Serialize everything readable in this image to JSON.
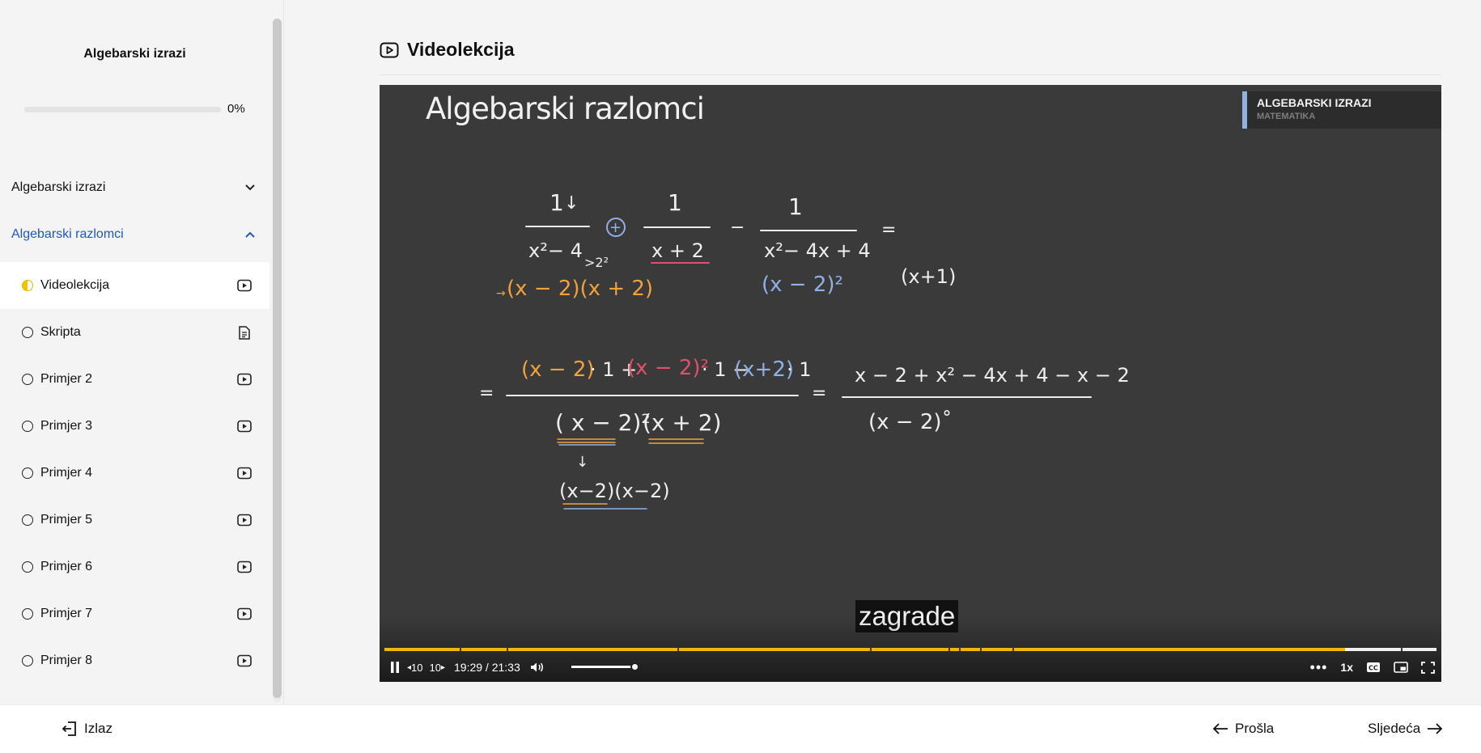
{
  "course": {
    "title": "Algebarski izrazi",
    "progress_percent": 0,
    "progress_label": "0%"
  },
  "sections": [
    {
      "label": "Algebarski izrazi",
      "expanded": false
    },
    {
      "label": "Algebarski razlomci",
      "expanded": true
    }
  ],
  "lessons": [
    {
      "label": "Videolekcija",
      "status": "in-progress",
      "icon": "video-icon",
      "current": true
    },
    {
      "label": "Skripta",
      "status": "not-started",
      "icon": "document-icon"
    },
    {
      "label": "Primjer 2",
      "status": "not-started",
      "icon": "video-icon"
    },
    {
      "label": "Primjer 3",
      "status": "not-started",
      "icon": "video-icon"
    },
    {
      "label": "Primjer 4",
      "status": "not-started",
      "icon": "video-icon"
    },
    {
      "label": "Primjer 5",
      "status": "not-started",
      "icon": "video-icon"
    },
    {
      "label": "Primjer 6",
      "status": "not-started",
      "icon": "video-icon"
    },
    {
      "label": "Primjer 7",
      "status": "not-started",
      "icon": "video-icon"
    },
    {
      "label": "Primjer 8",
      "status": "not-started",
      "icon": "video-icon"
    }
  ],
  "main": {
    "title": "Videolekcija"
  },
  "video": {
    "title": "Algebarski razlomci",
    "topic": "ALGEBARSKI IZRAZI",
    "subject": "MATEMATIKA",
    "caption": "zagrade",
    "time": "19:29 / 21:33",
    "skip_back": "10",
    "skip_forward": "10",
    "speed": "1x",
    "played_fraction": 0.913,
    "volume_fraction": 1.0
  },
  "footer": {
    "exit_label": "Izlaz",
    "prev_label": "Prošla",
    "next_label": "Sljedeća"
  },
  "colors": {
    "accent": "#1f57c3",
    "progress": "#f2b705",
    "in_progress": "#f2c400"
  }
}
